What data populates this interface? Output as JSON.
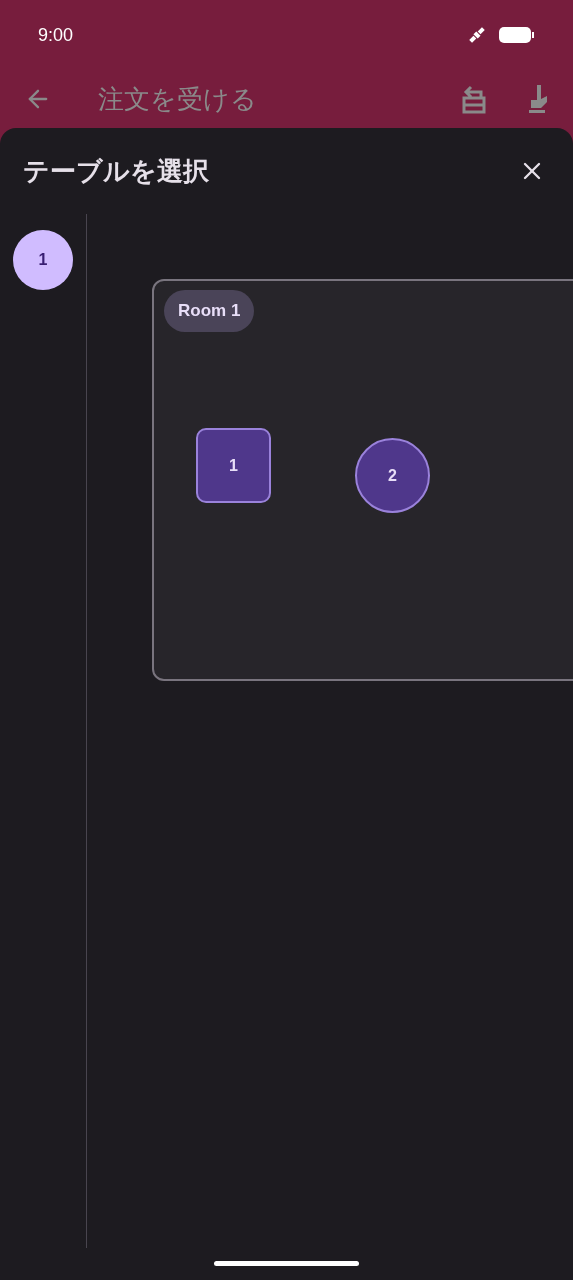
{
  "status_bar": {
    "time": "9:00"
  },
  "app_bar": {
    "title": "注文を受ける"
  },
  "sheet": {
    "title": "テーブルを選択",
    "floors": [
      {
        "label": "1",
        "selected": true
      }
    ],
    "room": {
      "label": "Room 1",
      "tables": [
        {
          "label": "1",
          "kind": "square"
        },
        {
          "label": "2",
          "kind": "round"
        }
      ]
    }
  }
}
